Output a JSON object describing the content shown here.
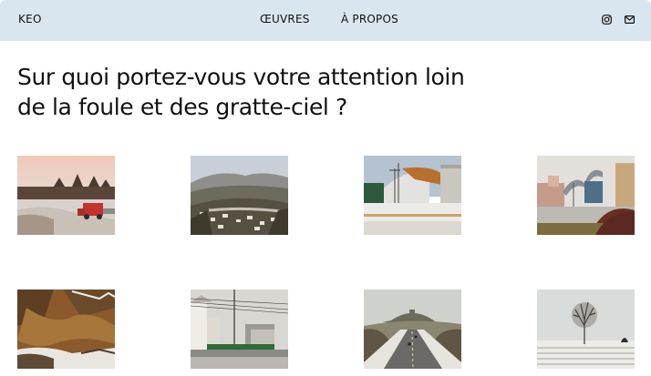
{
  "header": {
    "brand": "KEO",
    "nav": [
      {
        "label": "ŒUVRES"
      },
      {
        "label": "À PROPOS"
      }
    ],
    "icons": [
      "instagram-icon",
      "mail-icon"
    ]
  },
  "main": {
    "headline_line1": "Sur quoi portez-vous votre attention loin",
    "headline_line2": "de la foule et des gratte-ciel ?"
  },
  "colors": {
    "header_bg": "#dae6ef",
    "text": "#111111"
  }
}
